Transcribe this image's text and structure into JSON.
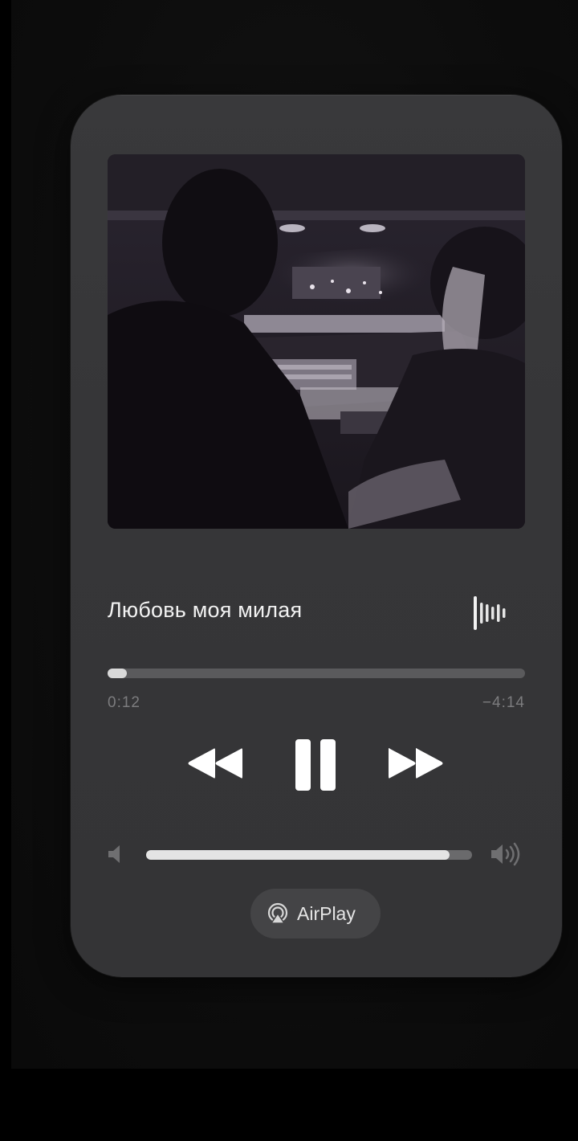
{
  "player": {
    "track_title": "Любовь моя милая",
    "elapsed": "0:12",
    "remaining": "−4:14",
    "progress_fraction": 0.046,
    "volume_fraction": 0.93,
    "airplay_label": "AirPlay"
  },
  "icons": {
    "waveform": "waveform-icon",
    "rewind": "rewind-icon",
    "pause": "pause-icon",
    "forward": "fast-forward-icon",
    "volume_low": "speaker-low-icon",
    "volume_high": "speaker-high-icon",
    "airplay": "airplay-icon"
  },
  "colors": {
    "card": "#39393b",
    "accent": "#ffffff",
    "track": "#5a5a5c",
    "secondary_text": "#7c7c7e"
  }
}
